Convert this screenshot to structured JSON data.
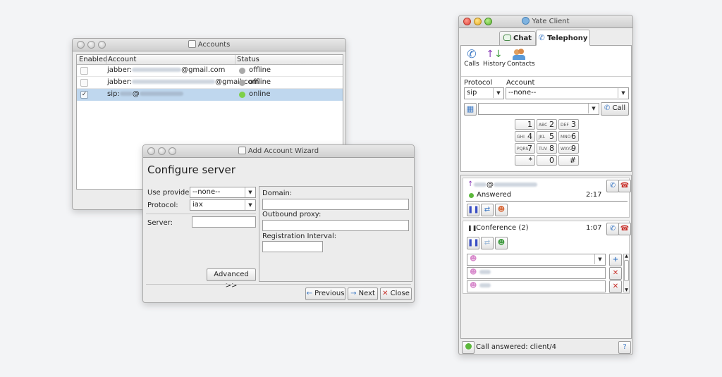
{
  "accounts_window": {
    "title": "Accounts",
    "columns": {
      "enabled": "Enabled",
      "account": "Account",
      "status": "Status"
    },
    "rows": [
      {
        "prefix": "jabber:",
        "suffix": "@gmail.com",
        "status": "offline",
        "status_color": "#a9a9a9",
        "enabled": false,
        "selected": false
      },
      {
        "prefix": "jabber:",
        "suffix": "@gmail.com",
        "status": "offline",
        "status_color": "#a9a9a9",
        "enabled": false,
        "selected": false
      },
      {
        "prefix": "sip:",
        "suffix": "@",
        "status": "online",
        "status_color": "#7ed04a",
        "enabled": true,
        "selected": true
      }
    ]
  },
  "wizard": {
    "title": "Add Account Wizard",
    "heading": "Configure server",
    "use_provider_label": "Use provider:",
    "use_provider_value": "--none--",
    "protocol_label": "Protocol:",
    "protocol_value": "iax",
    "server_label": "Server:",
    "domain_label": "Domain:",
    "outbound_proxy_label": "Outbound proxy:",
    "registration_interval_label": "Registration Interval:",
    "advanced_button": "Advanced >>",
    "previous_button": "Previous",
    "next_button": "Next",
    "close_button": "Close"
  },
  "yate": {
    "title": "Yate Client",
    "tabs": {
      "chat": "Chat",
      "telephony": "Telephony"
    },
    "toolbar": {
      "calls": "Calls",
      "history": "History",
      "contacts": "Contacts"
    },
    "protocol_label": "Protocol",
    "account_label": "Account",
    "protocol_value": "sip",
    "account_value": "--none--",
    "call_button": "Call",
    "keypad": [
      {
        "main": "1",
        "sub": ""
      },
      {
        "main": "2",
        "sub": "ABC"
      },
      {
        "main": "3",
        "sub": "DEF"
      },
      {
        "main": "4",
        "sub": "GHI"
      },
      {
        "main": "5",
        "sub": "JKL"
      },
      {
        "main": "6",
        "sub": "MNO"
      },
      {
        "main": "7",
        "sub": "PQRS"
      },
      {
        "main": "8",
        "sub": "TUV"
      },
      {
        "main": "9",
        "sub": "WXYZ"
      },
      {
        "main": "*",
        "sub": ""
      },
      {
        "main": "0",
        "sub": ""
      },
      {
        "main": "#",
        "sub": ""
      }
    ],
    "call1": {
      "status": "Answered",
      "status_color": "#5cb83c",
      "time": "2:17",
      "at": "@"
    },
    "conference": {
      "label": "Conference (2)",
      "time": "1:07"
    },
    "status_bar": "Call answered: client/4",
    "help": "?",
    "colors": {
      "accent": "#3b78c4",
      "hangup": "#c8302a"
    }
  }
}
